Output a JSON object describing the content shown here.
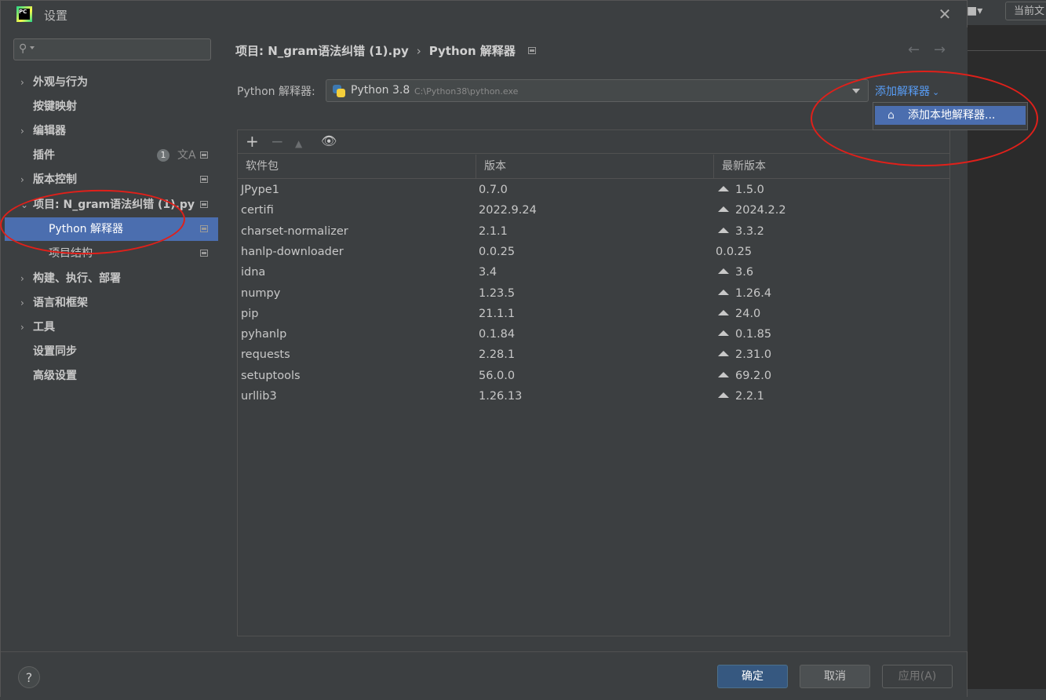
{
  "window": {
    "title": "设置",
    "app_logo_text": "PC"
  },
  "background": {
    "current_button": "当前文"
  },
  "sidebar": {
    "search_placeholder": "",
    "items": [
      {
        "label": "外观与行为",
        "expandable": true
      },
      {
        "label": "按键映射",
        "expandable": false
      },
      {
        "label": "编辑器",
        "expandable": true
      },
      {
        "label": "插件",
        "expandable": false,
        "badge": "1"
      },
      {
        "label": "版本控制",
        "expandable": true
      },
      {
        "label": "项目: N_gram语法纠错 (1).py",
        "expandable": true,
        "expanded": true
      },
      {
        "label": "Python 解释器",
        "child": true,
        "selected": true
      },
      {
        "label": "项目结构",
        "child": true
      },
      {
        "label": "构建、执行、部署",
        "expandable": true
      },
      {
        "label": "语言和框架",
        "expandable": true
      },
      {
        "label": "工具",
        "expandable": true
      },
      {
        "label": "设置同步",
        "expandable": false
      },
      {
        "label": "高级设置",
        "expandable": false
      }
    ]
  },
  "content": {
    "breadcrumb": {
      "project": "项目: N_gram语法纠错 (1).py",
      "page": "Python 解释器"
    },
    "interpreter_label": "Python 解释器:",
    "interpreter_name": "Python 3.8",
    "interpreter_path": "C:\\Python38\\python.exe",
    "add_interpreter_label": "添加解释器",
    "popup_item": "添加本地解释器...",
    "table": {
      "columns": [
        "软件包",
        "版本",
        "最新版本"
      ],
      "rows": [
        {
          "name": "JPype1",
          "version": "0.7.0",
          "latest": "1.5.0",
          "upgrade": true
        },
        {
          "name": "certifi",
          "version": "2022.9.24",
          "latest": "2024.2.2",
          "upgrade": true
        },
        {
          "name": "charset-normalizer",
          "version": "2.1.1",
          "latest": "3.3.2",
          "upgrade": true
        },
        {
          "name": "hanlp-downloader",
          "version": "0.0.25",
          "latest": "0.0.25",
          "upgrade": false
        },
        {
          "name": "idna",
          "version": "3.4",
          "latest": "3.6",
          "upgrade": true
        },
        {
          "name": "numpy",
          "version": "1.23.5",
          "latest": "1.26.4",
          "upgrade": true
        },
        {
          "name": "pip",
          "version": "21.1.1",
          "latest": "24.0",
          "upgrade": true
        },
        {
          "name": "pyhanlp",
          "version": "0.1.84",
          "latest": "0.1.85",
          "upgrade": true
        },
        {
          "name": "requests",
          "version": "2.28.1",
          "latest": "2.31.0",
          "upgrade": true
        },
        {
          "name": "setuptools",
          "version": "56.0.0",
          "latest": "69.2.0",
          "upgrade": true
        },
        {
          "name": "urllib3",
          "version": "1.26.13",
          "latest": "2.2.1",
          "upgrade": true
        }
      ]
    }
  },
  "footer": {
    "help_label": "?",
    "ok_label": "确定",
    "cancel_label": "取消",
    "apply_label": "应用(A)"
  },
  "colors": {
    "dialog_bg": "#3c3f41",
    "selection": "#4b6eaf",
    "link": "#589df6",
    "annotation": "#e0201a"
  }
}
